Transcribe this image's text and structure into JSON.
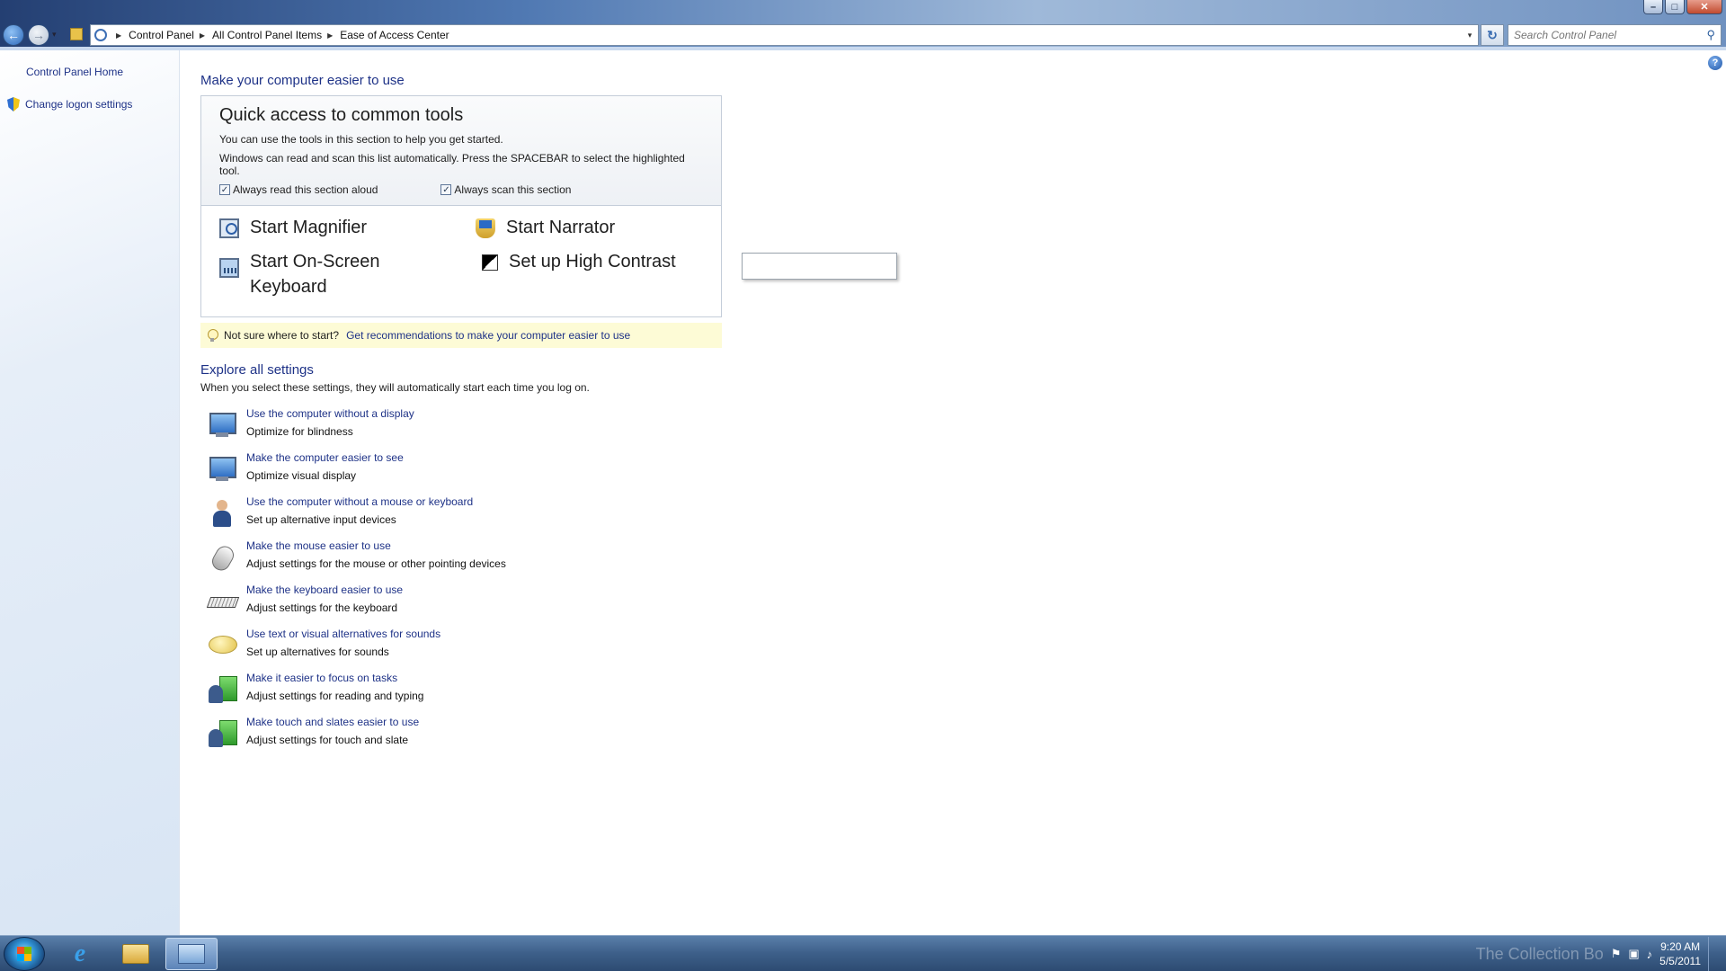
{
  "window": {
    "controls": [
      "–",
      "□",
      "✕"
    ]
  },
  "nav": {
    "back_glyph": "←",
    "forward_glyph": "→",
    "dropdown_glyph": "▾",
    "breadcrumb": [
      "Control Panel",
      "All Control Panel Items",
      "Ease of Access Center"
    ],
    "refresh_glyph": "↻",
    "search_placeholder": "Search Control Panel",
    "search_icon": "magnifier-icon"
  },
  "sidebar": {
    "items": [
      {
        "label": "Control Panel Home"
      },
      {
        "label": "Change logon settings",
        "icon": "shield-icon"
      }
    ]
  },
  "main": {
    "help_glyph": "?",
    "title": "Make your computer easier to use",
    "quick_access": {
      "title": "Quick access to common tools",
      "line1": "You can use the tools in this section to help you get started.",
      "line2": "Windows can read and scan this list automatically.  Press the SPACEBAR to select the highlighted tool.",
      "check_read": {
        "label": "Always read this section aloud",
        "checked": true
      },
      "check_scan": {
        "label": "Always scan this section",
        "checked": true
      },
      "check_glyph": "✓",
      "tools": [
        {
          "label": "Start Magnifier",
          "icon": "magnifier-icon"
        },
        {
          "label": "Start Narrator",
          "icon": "narrator-icon"
        },
        {
          "label": "Start On-Screen Keyboard",
          "label_line1": "Start On-Screen",
          "label_line2": "Keyboard",
          "icon": "keyboard-icon"
        },
        {
          "label": "Set up High Contrast",
          "icon": "contrast-icon"
        }
      ]
    },
    "hint": {
      "prefix": "Not sure where to start?",
      "link": "Get recommendations to make your computer easier to use"
    },
    "explore": {
      "title": "Explore all settings",
      "subtitle": "When you select these settings, they will automatically start each time you log on.",
      "items": [
        {
          "link": "Use the computer without a display",
          "desc": "Optimize for blindness",
          "icon": "monitor-icon"
        },
        {
          "link": "Make the computer easier to see",
          "desc": "Optimize visual display",
          "icon": "monitor-icon"
        },
        {
          "link": "Use the computer without a mouse or keyboard",
          "desc": "Set up alternative input devices",
          "icon": "person-icon"
        },
        {
          "link": "Make the mouse easier to use",
          "desc": "Adjust settings for the mouse or other pointing devices",
          "icon": "mouse-icon"
        },
        {
          "link": "Make the keyboard easier to use",
          "desc": "Adjust settings for the keyboard",
          "icon": "keyboard-icon"
        },
        {
          "link": "Use text or visual alternatives for sounds",
          "desc": "Set up alternatives for sounds",
          "icon": "speech-bubble-icon"
        },
        {
          "link": "Make it easier to focus on tasks",
          "desc": "Adjust settings for reading and typing",
          "icon": "people-icon"
        },
        {
          "link": "Make touch and slates easier to use",
          "desc": "Adjust settings for touch and slate",
          "icon": "people-icon"
        }
      ]
    }
  },
  "taskbar": {
    "ie_glyph": "e",
    "tray_glyphs": [
      "⚑",
      "▣",
      "♪"
    ],
    "watermark": "The Collection Bo",
    "time": "9:20 AM",
    "date": "5/5/2011"
  }
}
